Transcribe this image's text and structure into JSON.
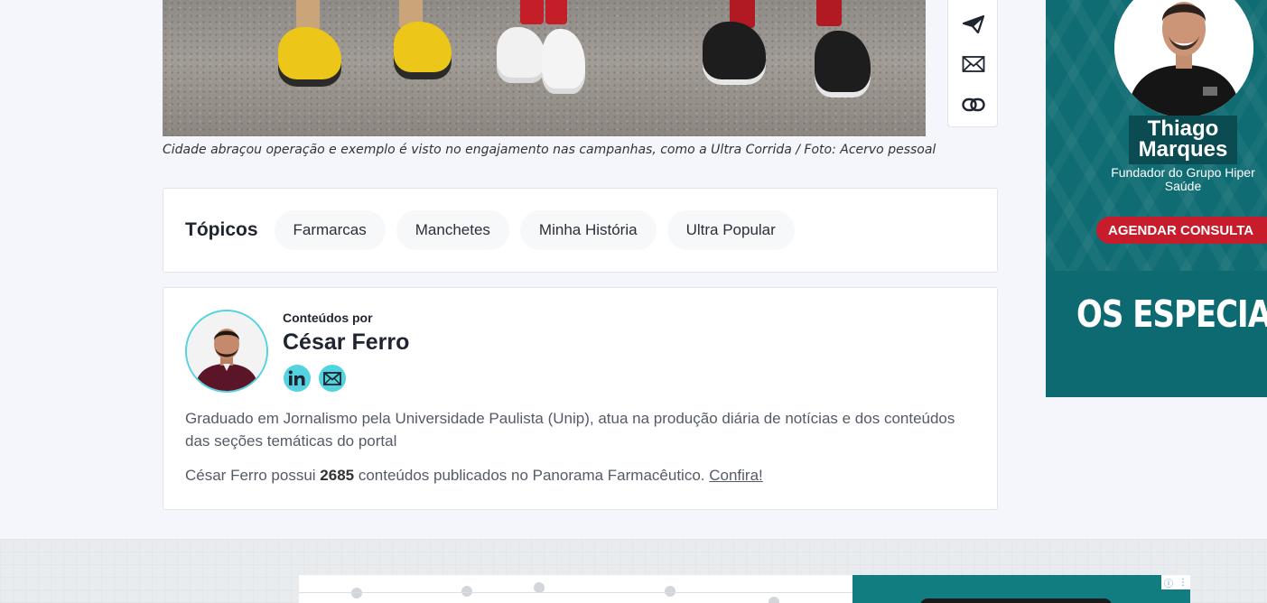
{
  "article": {
    "caption": "Cidade abraçou operação e exemplo é visto no engajamento nas campanhas, como a Ultra Corrida / Foto: Acervo pessoal"
  },
  "share": {
    "icons": [
      "send-icon",
      "mail-icon",
      "link-icon"
    ]
  },
  "topics": {
    "title": "Tópicos",
    "items": [
      "Farmarcas",
      "Manchetes",
      "Minha História",
      "Ultra Popular"
    ]
  },
  "author": {
    "by_label": "Conteúdos por",
    "name": "César Ferro",
    "social": [
      "linkedin-icon",
      "mail-icon"
    ],
    "bio": "Graduado em Jornalismo pela Universidade Paulista (Unip), atua na produção diária de notícias e dos conteúdos das seções temáticas do portal",
    "count_prefix": "César Ferro possui ",
    "count": "2685",
    "count_suffix": " conteúdos publicados no Panorama Farmacêutico. ",
    "count_link": "Confira!"
  },
  "ad": {
    "name": "Thiago Marques",
    "subtitle": "Fundador do Grupo Hiper Saúde",
    "cta": "AGENDAR CONSULTA",
    "banner_text": "OS ESPECIALISTA",
    "colors": {
      "background": "#0f6c73",
      "cta": "#c71c2b"
    }
  },
  "colors": {
    "accent": "#54d2e0",
    "page_bg": "#f4f6fb"
  }
}
